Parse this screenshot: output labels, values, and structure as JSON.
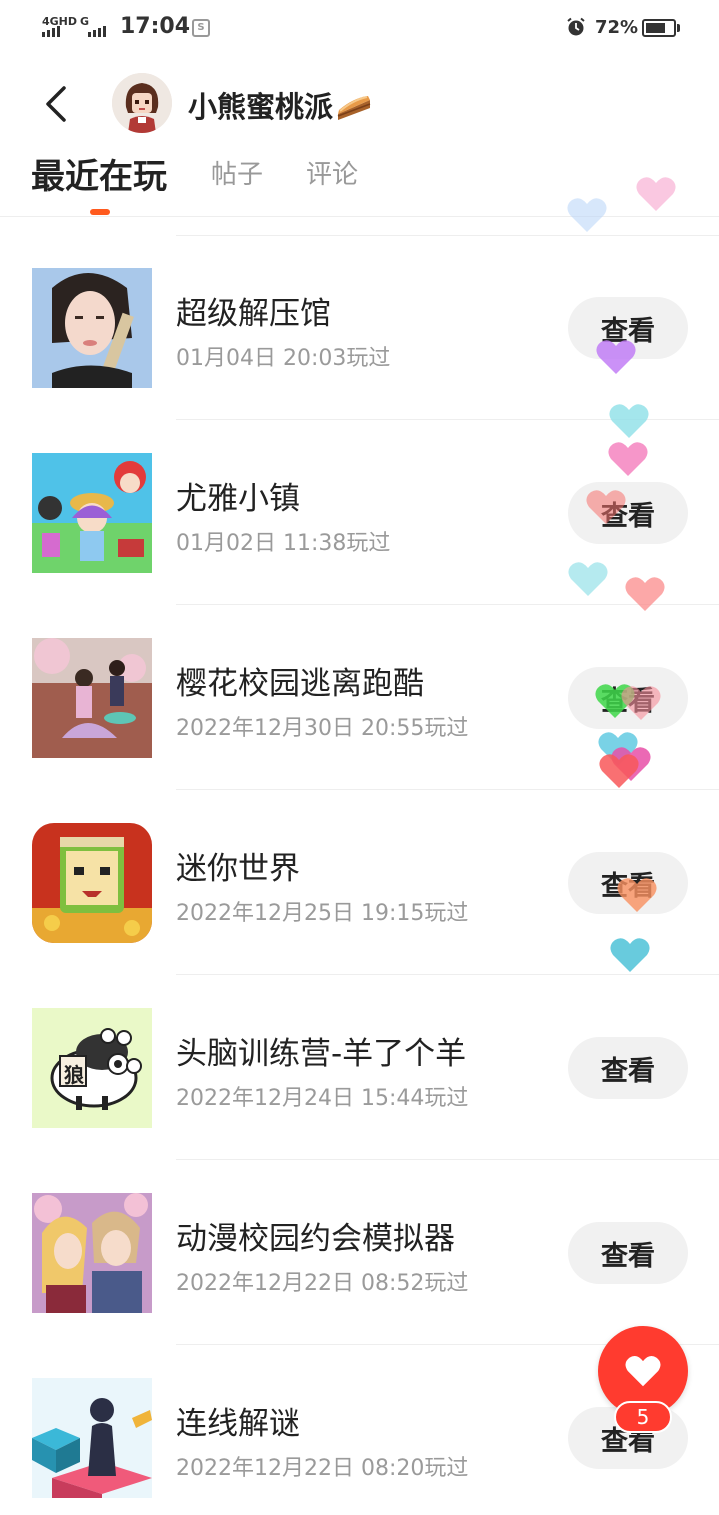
{
  "status_bar": {
    "network_label": "4GHD",
    "network2_label": "G",
    "time": "17:04",
    "battery_percent": "72%",
    "battery_level": 0.72
  },
  "header": {
    "username": "小熊蜜桃派",
    "pie_icon": "pie-emoji-icon"
  },
  "tabs": [
    {
      "label": "最近在玩",
      "active": true
    },
    {
      "label": "帖子",
      "active": false
    },
    {
      "label": "评论",
      "active": false
    }
  ],
  "games": [
    {
      "title": "超级解压馆",
      "played": "01月04日 20:03玩过",
      "button": "查看"
    },
    {
      "title": "尤雅小镇",
      "played": "01月02日 11:38玩过",
      "button": "查看"
    },
    {
      "title": "樱花校园逃离跑酷",
      "played": "2022年12月30日 20:55玩过",
      "button": "查看"
    },
    {
      "title": "迷你世界",
      "played": "2022年12月25日 19:15玩过",
      "button": "查看"
    },
    {
      "title": "头脑训练营-羊了个羊",
      "played": "2022年12月24日 15:44玩过",
      "button": "查看"
    },
    {
      "title": "动漫校园约会模拟器",
      "played": "2022年12月22日 08:52玩过",
      "button": "查看"
    },
    {
      "title": "连线解谜",
      "played": "2022年12月22日 08:20玩过",
      "button": "查看"
    }
  ],
  "thumb_text": {
    "sheep_tile": "狼"
  },
  "fab": {
    "icon": "heart-icon",
    "badge_count": "5"
  },
  "colors": {
    "accent": "#ff5a1e",
    "fab": "#ff3b2f",
    "button_bg": "#f1f1f1"
  }
}
